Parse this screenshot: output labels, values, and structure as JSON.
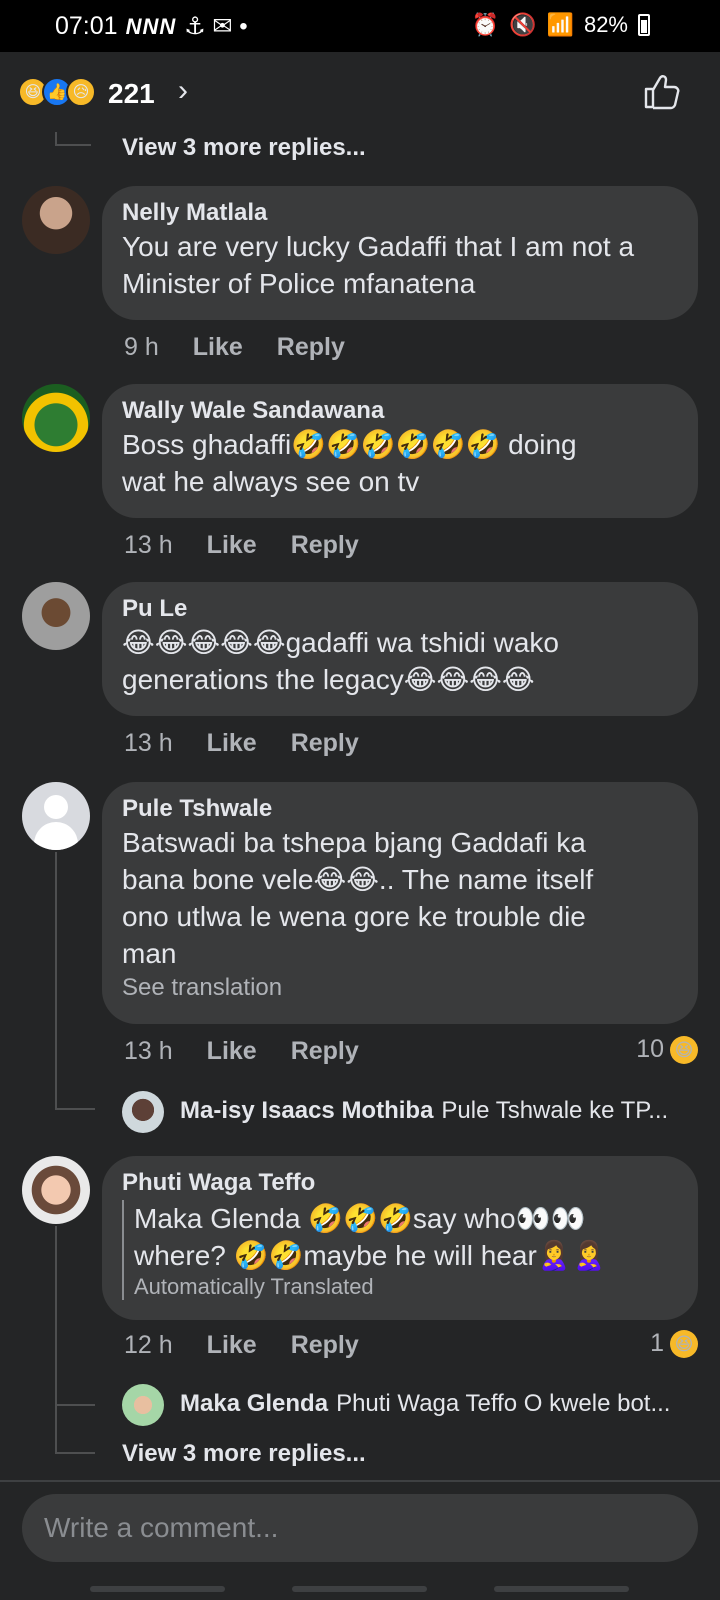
{
  "status_bar": {
    "time": "07:01",
    "left_icons": "NNN",
    "battery": "82%"
  },
  "reactions": {
    "count": "221",
    "chevron": "›"
  },
  "thread_top": {
    "view_more": "View 3 more replies..."
  },
  "comments": [
    {
      "name": "Nelly Matlala",
      "text_lines": [
        "You are very lucky Gadaffi that I am not a",
        "Minister of Police mfanatena"
      ],
      "time": "9 h",
      "like": "Like",
      "reply": "Reply"
    },
    {
      "name": "Wally Wale Sandawana",
      "text_lines": [
        "Boss ghadaffi🤣🤣🤣🤣🤣🤣 doing",
        "wat he always see on tv"
      ],
      "time": "13 h",
      "like": "Like",
      "reply": "Reply"
    },
    {
      "name": "Pu Le",
      "text_lines": [
        "😂😂😂😂😂gadaffi wa tshidi wako",
        "generations the legacy😂😂😂😂"
      ],
      "time": "13 h",
      "like": "Like",
      "reply": "Reply"
    },
    {
      "name": "Pule Tshwale",
      "text_lines": [
        "Batswadi ba tshepa bjang Gaddafi ka",
        "bana bone vele😂😂.. The name itself",
        "ono utlwa le wena gore ke trouble die",
        "man"
      ],
      "see_translation": "See translation",
      "time": "13 h",
      "like": "Like",
      "reply": "Reply",
      "reaction_count": "10",
      "reply_preview": {
        "name": "Ma-isy Isaacs Mothiba",
        "text": "Pule Tshwale ke TP..."
      }
    },
    {
      "name": "Phuti Waga Teffo",
      "text_lines": [
        "Maka Glenda 🤣🤣🤣say who👀👀",
        "where? 🤣🤣maybe he will hear🙎‍♀️🙎‍♀️"
      ],
      "translated_label": "Automatically Translated",
      "time": "12 h",
      "like": "Like",
      "reply": "Reply",
      "reaction_count": "1",
      "reply_preview": {
        "name": "Maka Glenda",
        "text": "Phuti Waga Teffo O kwele bot..."
      },
      "view_more": "View 3 more replies..."
    }
  ],
  "composer": {
    "placeholder": "Write a comment..."
  },
  "colors": {
    "background": "#242526",
    "bubble": "#3a3b3c",
    "text": "#e4e6eb",
    "muted": "#b0b3b8",
    "accent_like": "#1877f2",
    "haha": "#f7b928"
  },
  "icons": [
    "haha-icon",
    "like-icon",
    "sad-icon",
    "chevron-right-icon",
    "thumbs-up-icon",
    "battery-icon",
    "wifi-icon",
    "alarm-icon",
    "mute-icon"
  ]
}
